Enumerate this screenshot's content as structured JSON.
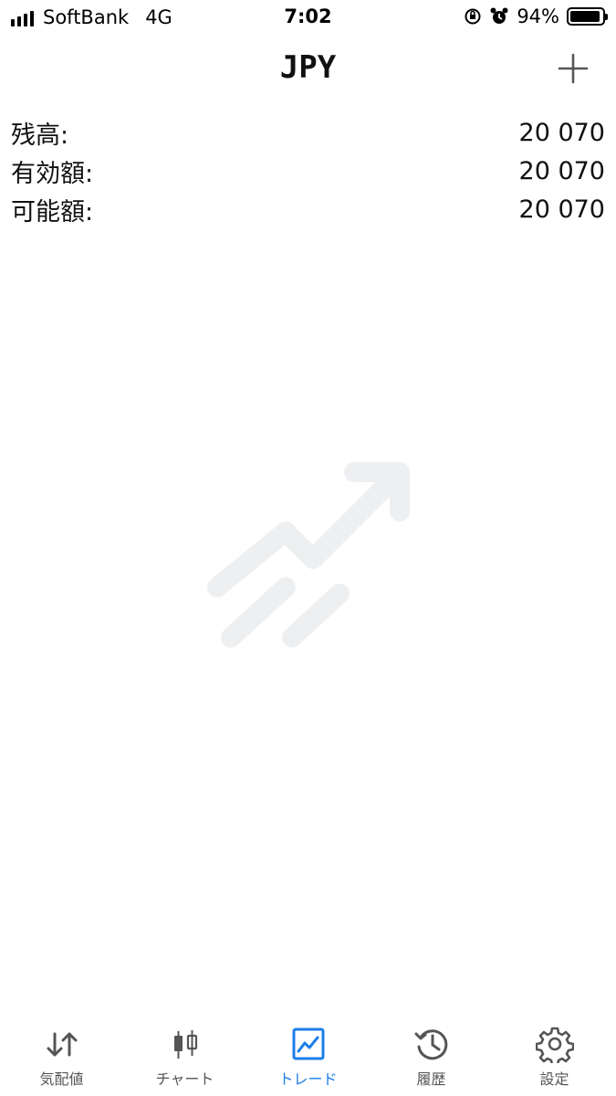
{
  "status_bar": {
    "carrier": "SoftBank",
    "network": "4G",
    "time": "7:02",
    "battery": "94%",
    "battery_level": 0.94
  },
  "header": {
    "title": "JPY",
    "add_icon": "plus-icon"
  },
  "account": {
    "rows": [
      {
        "label": "残高:",
        "value": "20 070"
      },
      {
        "label": "有効額:",
        "value": "20 070"
      },
      {
        "label": "可能額:",
        "value": "20 070"
      }
    ]
  },
  "empty_state": {
    "icon": "trade-chart-icon",
    "color": "#eeeff1"
  },
  "tab_bar": {
    "active_color": "#1b7ee8",
    "inactive_color": "#555555",
    "tabs": [
      {
        "label": "気配値",
        "icon": "quotes-arrows-icon"
      },
      {
        "label": "チャート",
        "icon": "candlestick-icon"
      },
      {
        "label": "トレード",
        "icon": "trade-icon"
      },
      {
        "label": "履歴",
        "icon": "history-clock-icon"
      },
      {
        "label": "設定",
        "icon": "gear-icon"
      }
    ]
  }
}
